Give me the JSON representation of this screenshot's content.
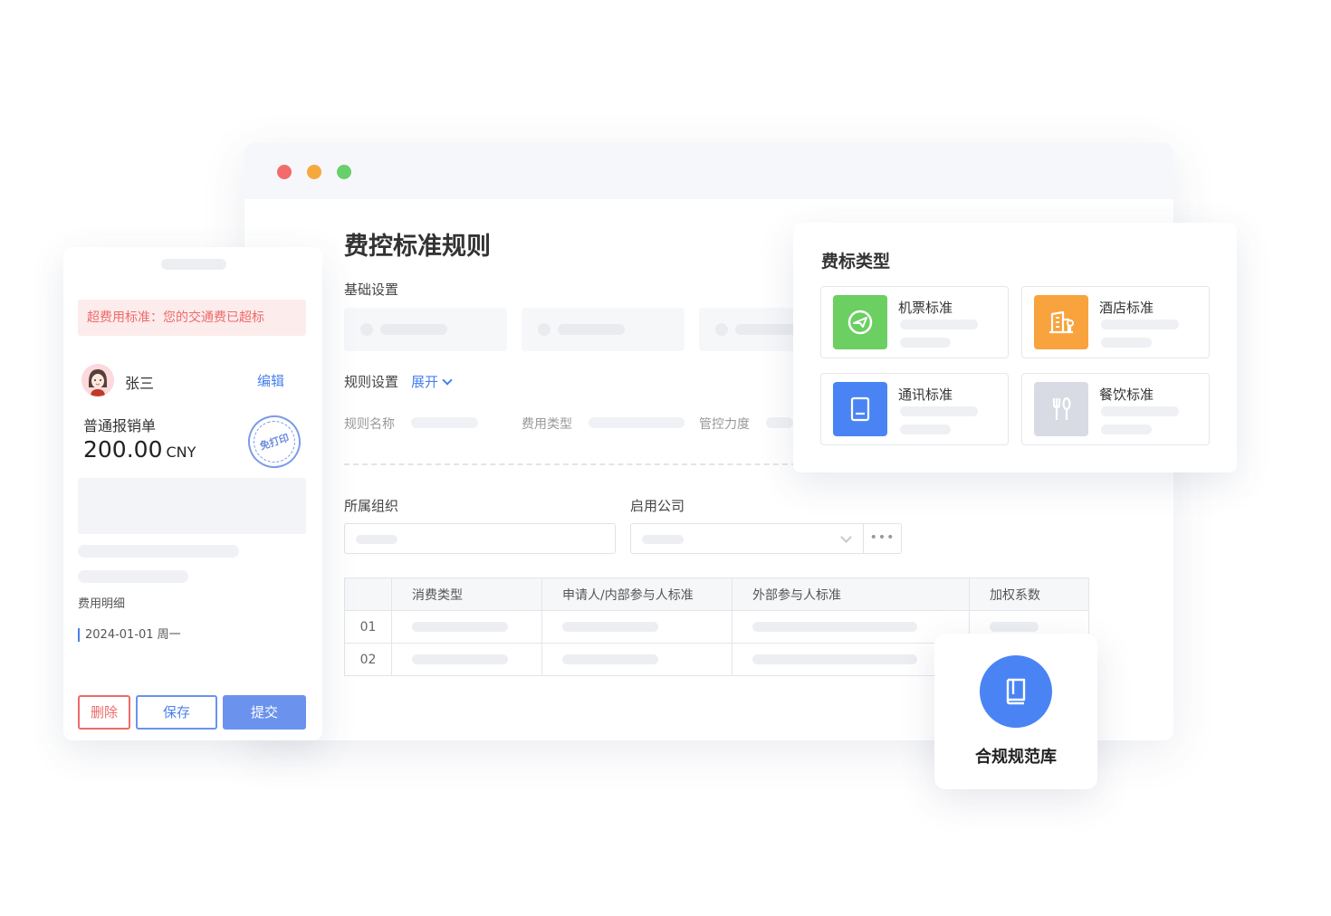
{
  "window": {
    "title": "费控标准规则",
    "basic_settings_label": "基础设置",
    "rule_settings_label": "规则设置",
    "expand_label": "展开",
    "rule_fields": [
      "规则名称",
      "费用类型",
      "管控力度"
    ],
    "org_label": "所属组织",
    "company_label": "启用公司",
    "more_label": "•••",
    "table": {
      "headers": [
        "",
        "消费类型",
        "申请人/内部参与人标准",
        "外部参与人标准",
        "加权系数"
      ],
      "rows": [
        "01",
        "02"
      ]
    }
  },
  "mobile": {
    "alert": "超费用标准：您的交通费已超标",
    "user_name": "张三",
    "edit_label": "编辑",
    "doc_type": "普通报销单",
    "amount": "200.00",
    "currency": "CNY",
    "stamp_text": "免打印",
    "detail_label": "费用明细",
    "date": "2024-01-01 周一",
    "buttons": {
      "delete": "删除",
      "save": "保存",
      "submit": "提交"
    }
  },
  "panel": {
    "title": "费标类型",
    "categories": [
      {
        "label": "机票标准",
        "icon": "plane-icon",
        "color": "#6bcf62"
      },
      {
        "label": "酒店标准",
        "icon": "hotel-icon",
        "color": "#f8a33d"
      },
      {
        "label": "通讯标准",
        "icon": "tablet-icon",
        "color": "#4a84f4"
      },
      {
        "label": "餐饮标准",
        "icon": "dining-icon",
        "color": "#d8dbe3"
      }
    ]
  },
  "compliance": {
    "label": "合规规范库",
    "icon": "book-icon"
  },
  "colors": {
    "accent": "#4a80f0",
    "danger": "#ee6a6a",
    "dot_red": "#f46b6b",
    "dot_yellow": "#f6a83e",
    "dot_green": "#69cf6b"
  }
}
